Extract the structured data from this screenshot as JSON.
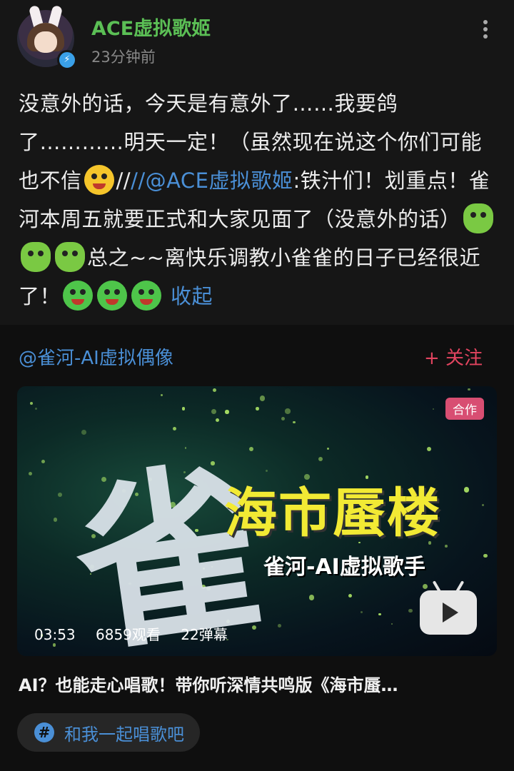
{
  "post": {
    "author": "ACE虚拟歌姬",
    "time": "23分钟前",
    "text_part1": "没意外的话，今天是有意外了……我要鸽了…………明天一定！（虽然现在说这个你们可能也不信",
    "mention": "//@ACE虚拟歌姬",
    "text_part2": ":铁汁们！划重点！雀河本周五就要正式和大家见面了（没意外的话）",
    "text_part3": "总之~~离快乐调教小雀雀的日子已经很近了！",
    "collapse_label": "收起"
  },
  "repost": {
    "author": "@雀河-AI虚拟偶像",
    "follow_label": "+ 关注",
    "video": {
      "badge": "合作",
      "art_big_char": "雀",
      "art_title": "海市蜃楼",
      "art_subtitle": "雀河-AI虚拟歌手",
      "duration": "03:53",
      "views": "6859观看",
      "danmaku": "22弹幕",
      "caption": "AI？也能走心唱歌！带你听深情共鸣版《海市蜃…"
    },
    "topic": "和我一起唱歌吧"
  },
  "colors": {
    "accent_blue": "#4a8fd6",
    "author_green": "#5bbf55",
    "follow_pink": "#e2445f",
    "badge_pink": "#d84e72"
  },
  "icons": [
    "more-vert-icon",
    "verified-icon",
    "play-icon",
    "hashtag-icon"
  ]
}
